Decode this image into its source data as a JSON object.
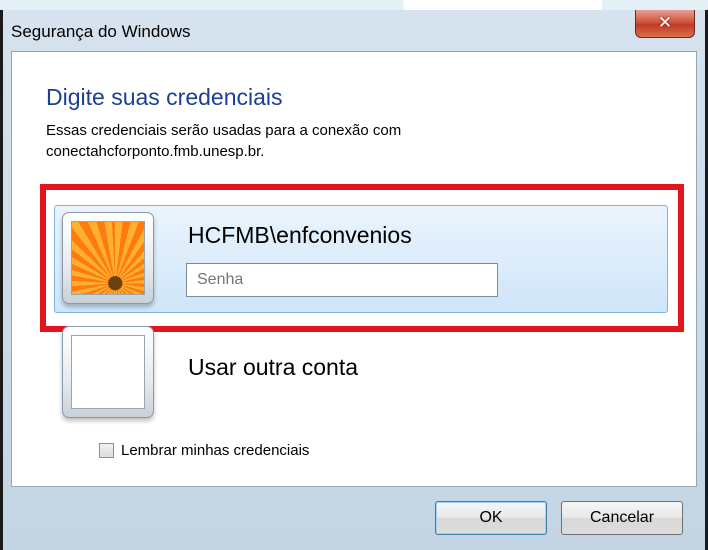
{
  "window": {
    "title": "Segurança do Windows",
    "close_glyph": "✕"
  },
  "dialog": {
    "heading": "Digite suas credenciais",
    "description_line1": "Essas credenciais serão usadas para a conexão com",
    "description_line2": "conectahcforponto.fmb.unesp.br."
  },
  "credential_tile": {
    "username": "HCFMB\\enfconvenios",
    "password_value": "",
    "password_placeholder": "Senha",
    "avatar_icon": "flower-avatar-icon"
  },
  "other_account_tile": {
    "label": "Usar outra conta",
    "avatar_icon": "blank-avatar-icon"
  },
  "remember": {
    "label": "Lembrar minhas credenciais",
    "checked": false
  },
  "buttons": {
    "ok_label": "OK",
    "cancel_label": "Cancelar"
  },
  "colors": {
    "heading": "#1c3f95",
    "highlight_box": "#e4141d",
    "selection": "#cfe5f9"
  }
}
